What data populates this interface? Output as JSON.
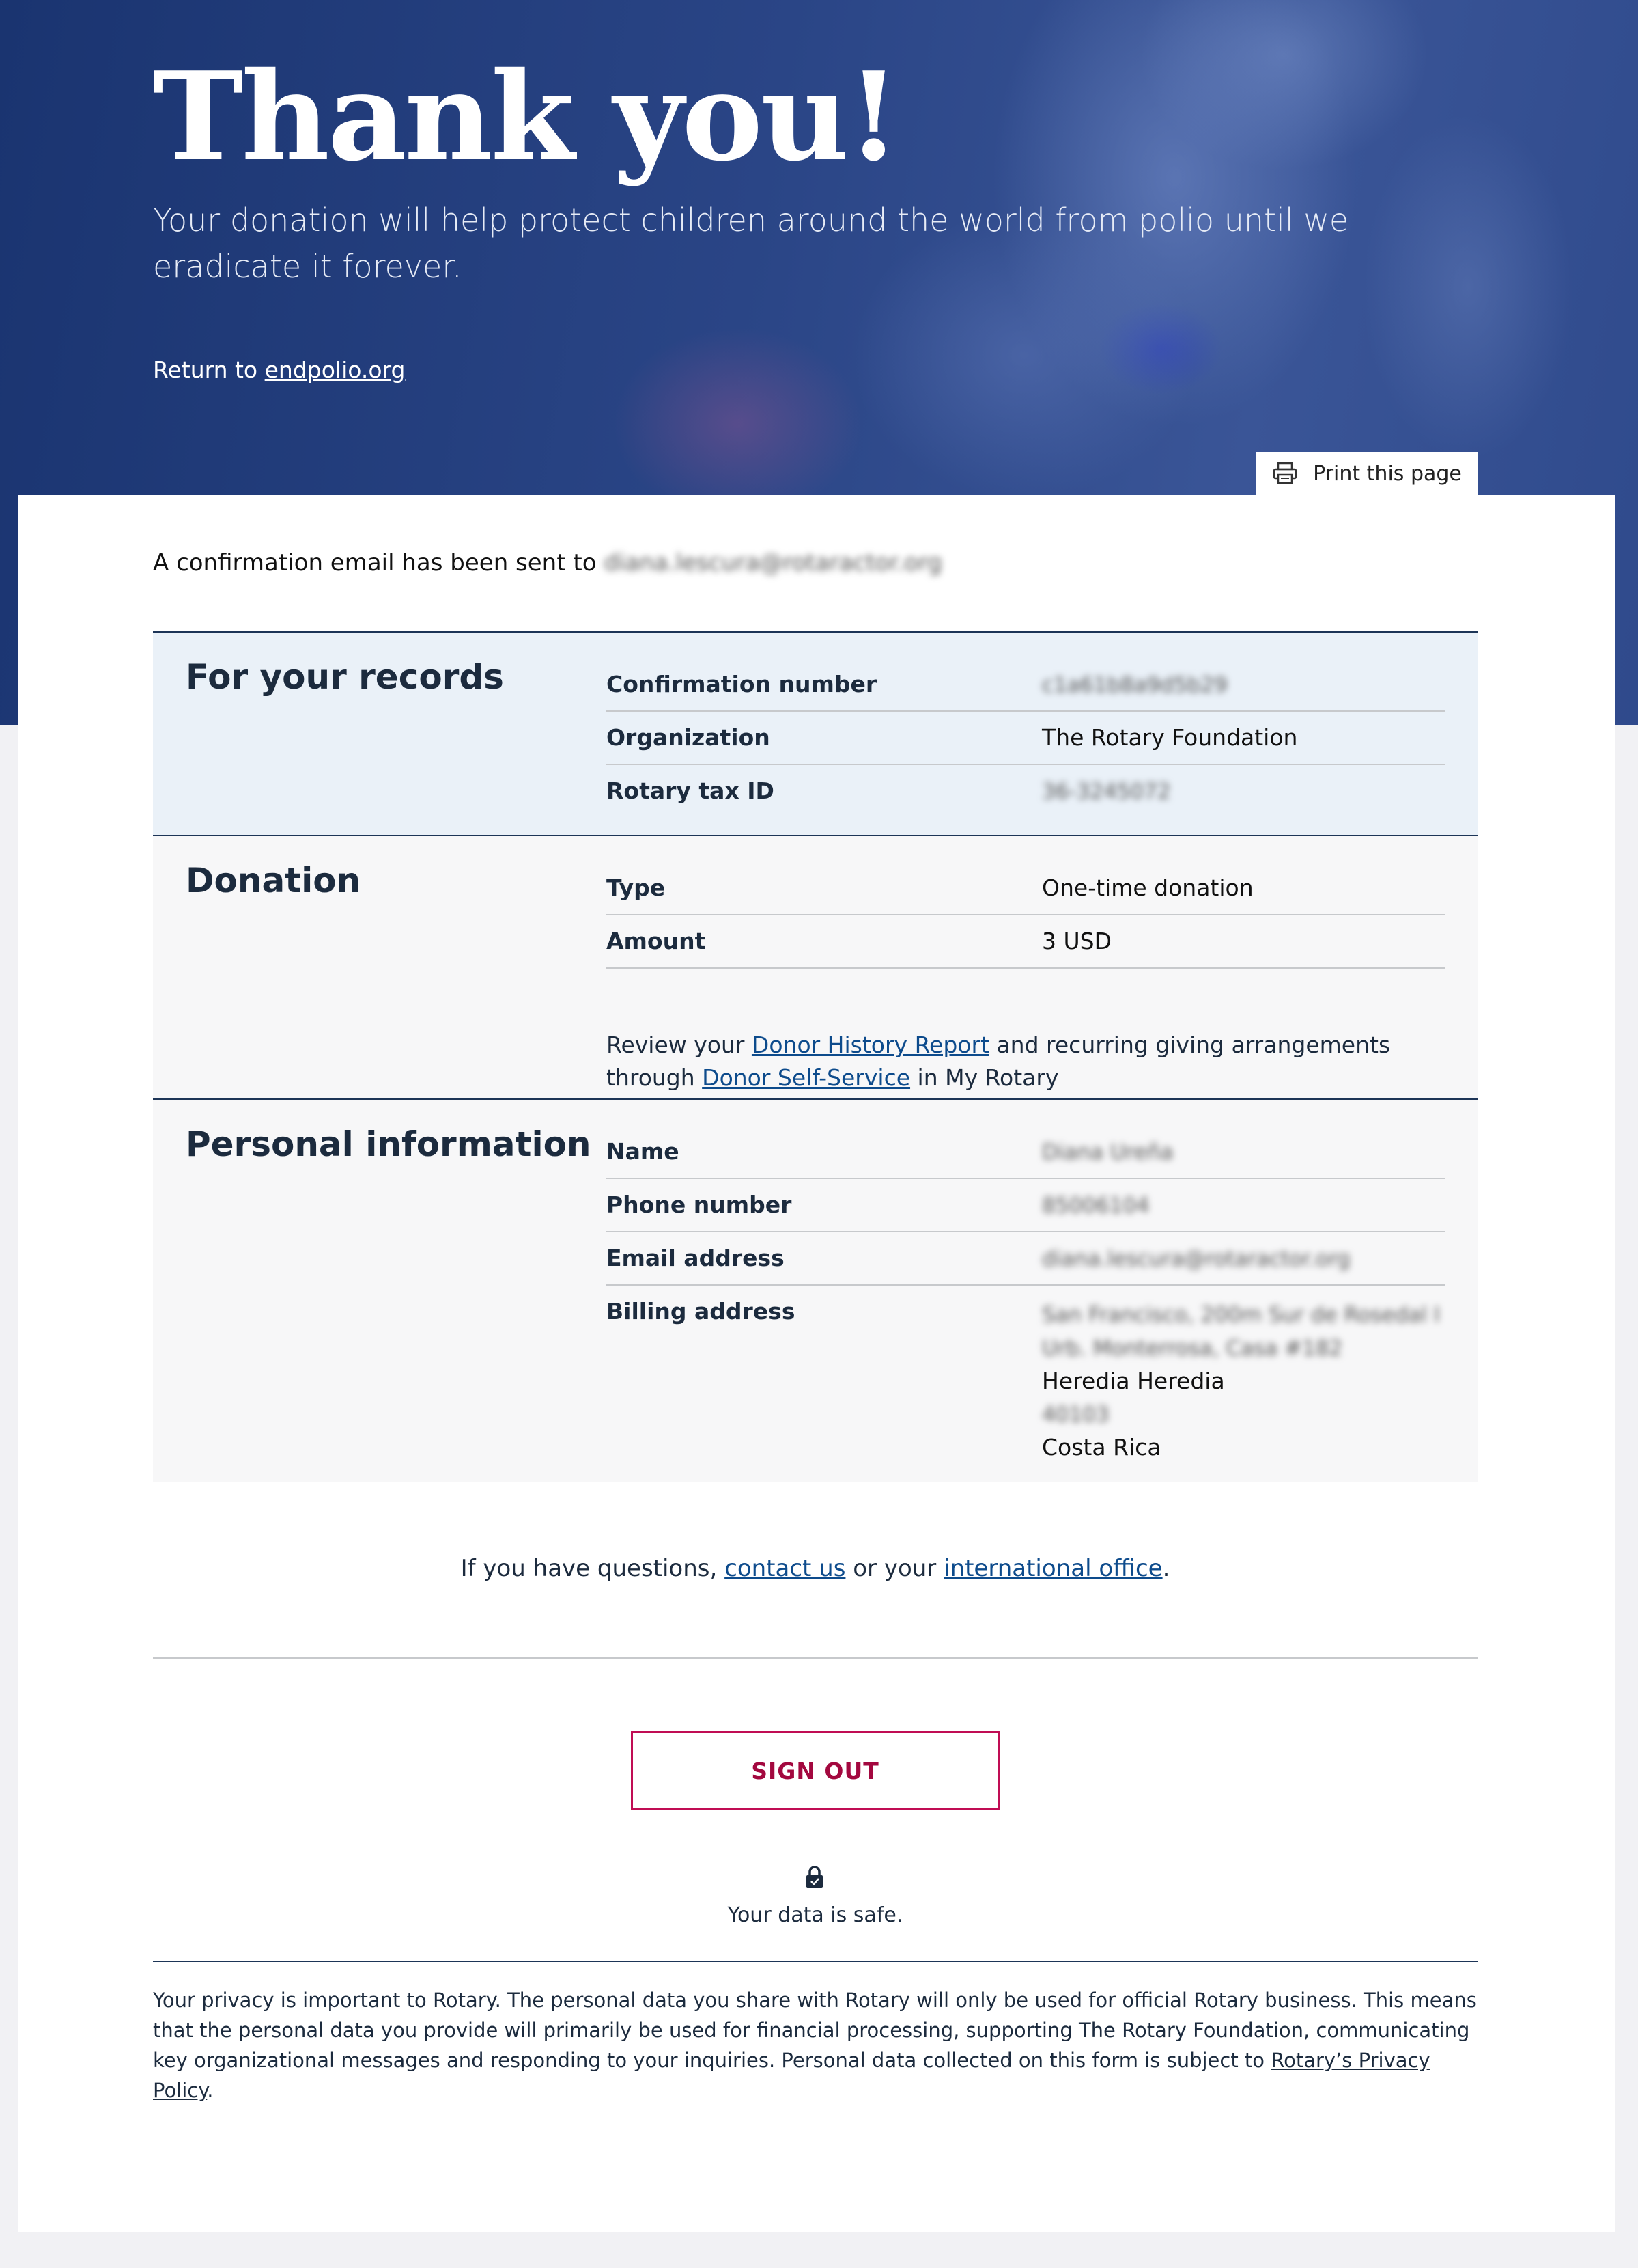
{
  "hero": {
    "title": "Thank you!",
    "subtitle": "Your donation will help protect children around the world from polio until we eradicate it forever.",
    "return_prefix": "Return to ",
    "return_link": "endpolio.org"
  },
  "print_button": {
    "label": "Print this page",
    "icon": "printer-icon"
  },
  "confirmation": {
    "text": "A confirmation email has been sent to ",
    "email": "diana.lescura@rotaractor.org"
  },
  "records": {
    "title": "For your records",
    "rows": [
      {
        "label": "Confirmation number",
        "value": "c1a61b8a9d5b29"
      },
      {
        "label": "Organization",
        "value": "The Rotary Foundation"
      },
      {
        "label": "Rotary tax ID",
        "value": "36-3245072"
      }
    ]
  },
  "donation": {
    "title": "Donation",
    "rows": [
      {
        "label": "Type",
        "value": "One-time donation"
      },
      {
        "label": "Amount",
        "value": "3 USD"
      }
    ],
    "review_prefix": "Review your ",
    "review_link1": "Donor History Report",
    "review_mid": " and recurring giving arrangements through ",
    "review_link2": "Donor Self-Service",
    "review_suffix": " in My Rotary"
  },
  "personal": {
    "title": "Personal information",
    "rows": [
      {
        "label": "Name",
        "value": "Diana Ureña"
      },
      {
        "label": "Phone number",
        "value": "85006104"
      },
      {
        "label": "Email address",
        "value": "diana.lescura@rotaractor.org"
      },
      {
        "label": "Billing address",
        "value": ""
      }
    ],
    "address": {
      "line1": "San Francisco, 200m Sur de Rosedal I",
      "line2": "Urb. Monterrosa, Casa #182",
      "line3": "Heredia Heredia",
      "line4": "40103",
      "line5": "Costa Rica"
    }
  },
  "questions": {
    "prefix": "If you have questions, ",
    "link1": "contact us",
    "mid": " or your ",
    "link2": "international office",
    "suffix": "."
  },
  "signout": {
    "label": "SIGN OUT"
  },
  "safety": {
    "text": "Your data is safe.",
    "icon": "lock-icon"
  },
  "privacy": {
    "text": "Your privacy is important to Rotary. The personal data you share with Rotary will only be used for official Rotary business. This means that the personal data you provide will primarily be used for financial processing, supporting The Rotary Foundation, communicating key organizational messages and responding to your inquiries. Personal data collected on this form is subject to ",
    "link": "Rotary’s Privacy Policy",
    "suffix": "."
  },
  "colors": {
    "hero_blue": "#2a4586",
    "navy_text": "#1c2b3e",
    "link_blue": "#0d4b8c",
    "signout_red": "#c00d54",
    "records_bg": "#eaf1f8"
  }
}
